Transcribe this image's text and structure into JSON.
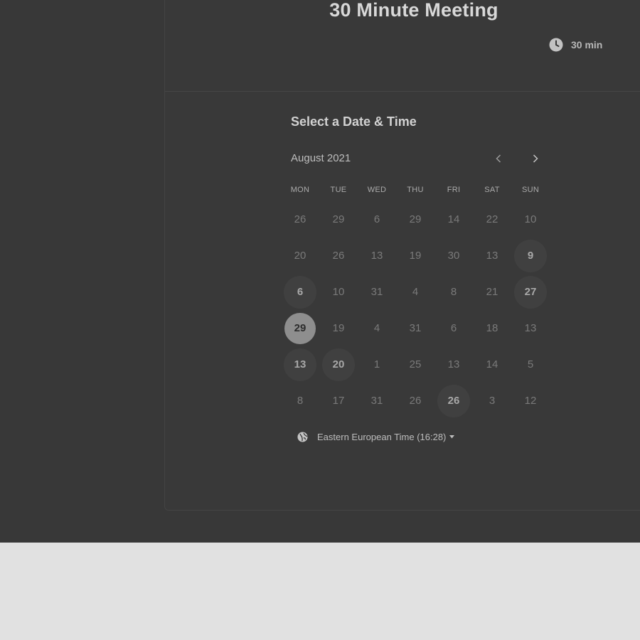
{
  "event": {
    "title": "30 Minute Meeting",
    "duration": "30 min"
  },
  "scheduler": {
    "heading": "Select a Date & Time",
    "month_label": "August 2021",
    "weekdays": [
      "MON",
      "TUE",
      "WED",
      "THU",
      "FRI",
      "SAT",
      "SUN"
    ],
    "weeks": [
      [
        {
          "d": "26"
        },
        {
          "d": "29"
        },
        {
          "d": "6"
        },
        {
          "d": "29"
        },
        {
          "d": "14"
        },
        {
          "d": "22"
        },
        {
          "d": "10"
        }
      ],
      [
        {
          "d": "20"
        },
        {
          "d": "26"
        },
        {
          "d": "13"
        },
        {
          "d": "19"
        },
        {
          "d": "30"
        },
        {
          "d": "13"
        },
        {
          "d": "9",
          "available": true
        }
      ],
      [
        {
          "d": "6",
          "available": true
        },
        {
          "d": "10"
        },
        {
          "d": "31"
        },
        {
          "d": "4"
        },
        {
          "d": "8"
        },
        {
          "d": "21"
        },
        {
          "d": "27",
          "available": true
        }
      ],
      [
        {
          "d": "29",
          "available": true,
          "selected": true
        },
        {
          "d": "19"
        },
        {
          "d": "4"
        },
        {
          "d": "31"
        },
        {
          "d": "6"
        },
        {
          "d": "18"
        },
        {
          "d": "13"
        }
      ],
      [
        {
          "d": "13",
          "available": true
        },
        {
          "d": "20",
          "available": true
        },
        {
          "d": "1"
        },
        {
          "d": "25"
        },
        {
          "d": "13"
        },
        {
          "d": "14"
        },
        {
          "d": "5"
        }
      ],
      [
        {
          "d": "8"
        },
        {
          "d": "17"
        },
        {
          "d": "31"
        },
        {
          "d": "26"
        },
        {
          "d": "26",
          "available": true
        },
        {
          "d": "3"
        },
        {
          "d": "12"
        }
      ]
    ]
  },
  "timezone": {
    "label": "Eastern European Time (16:28)"
  },
  "icons": {
    "duration": "clock-icon",
    "timezone": "globe-icon",
    "prev_month": "chevron-left-icon",
    "next_month": "chevron-right-icon",
    "timezone_dropdown": "caret-down-icon"
  },
  "colors": {
    "overlay": "#383838",
    "card": "#393939",
    "page_background": "#e1e1e1",
    "selected_day": "#8e8e8e",
    "available_day": "#404040"
  }
}
